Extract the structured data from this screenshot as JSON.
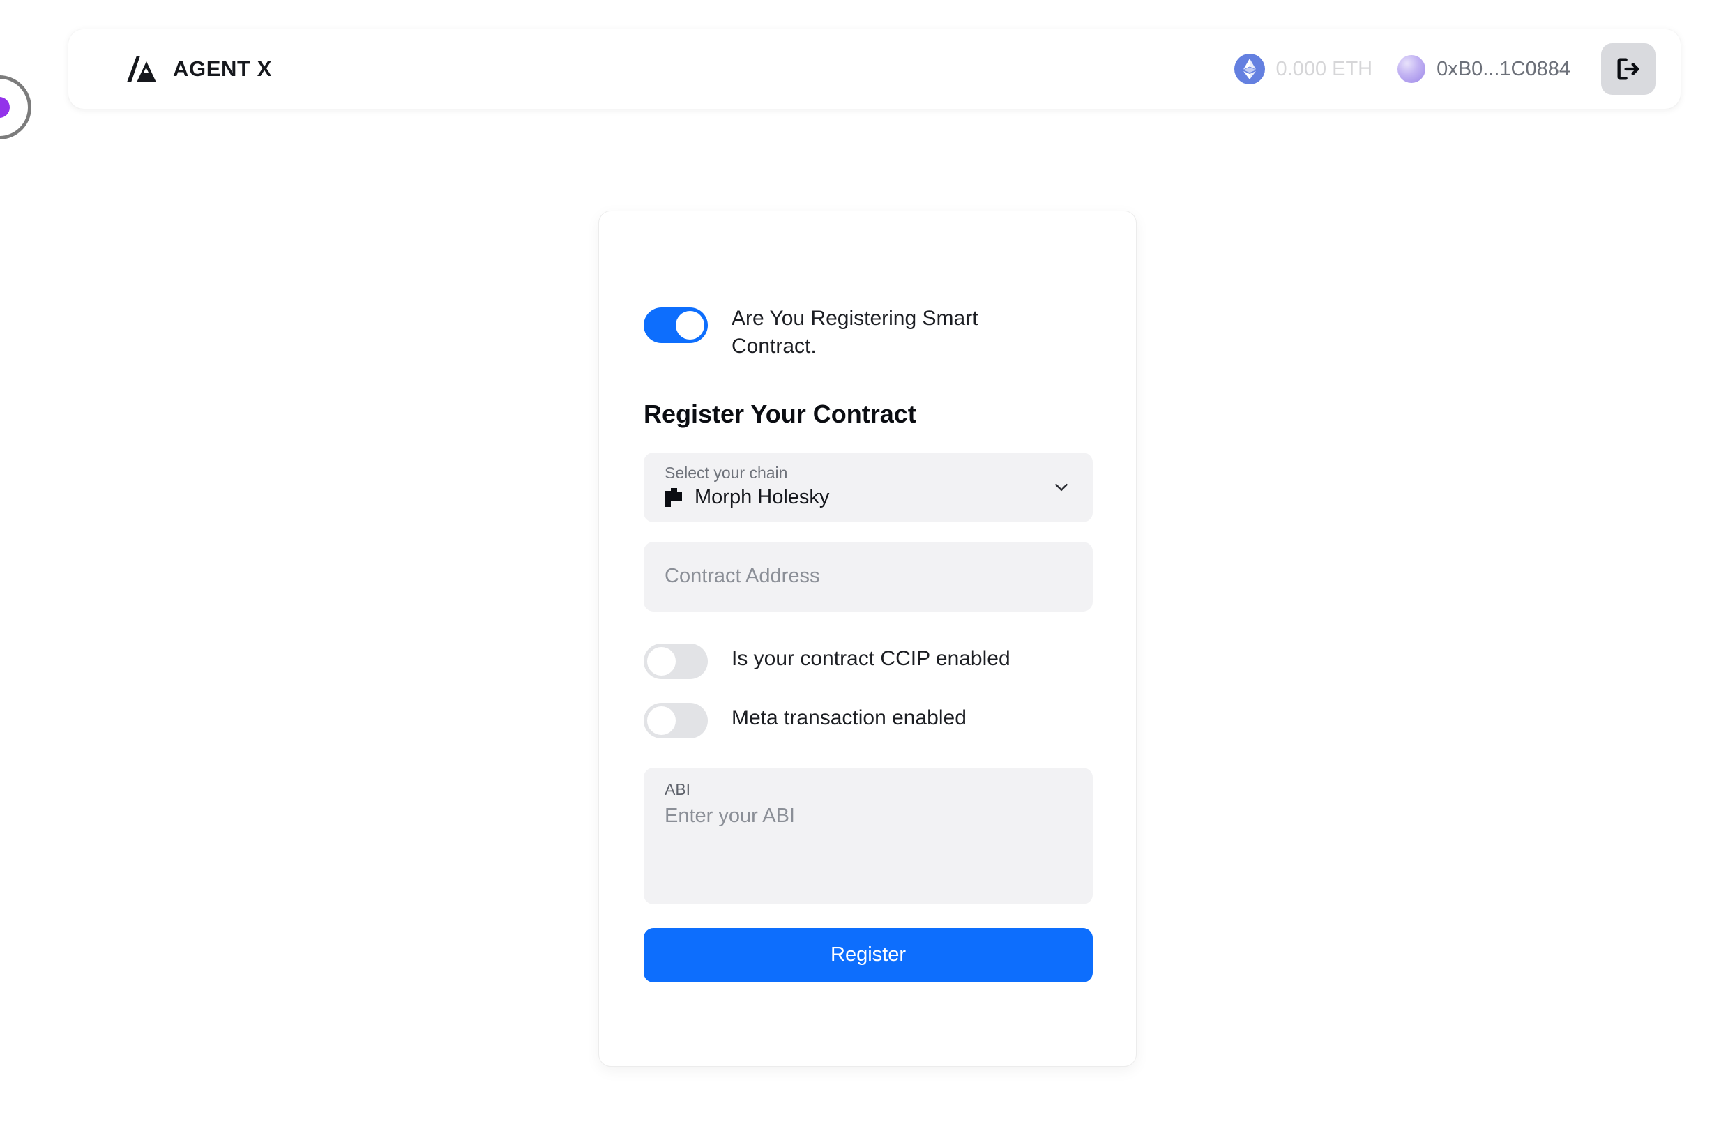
{
  "header": {
    "brand_name": "AGENT X",
    "brand_logo_icon": "agent-x-triangle-logo",
    "balance": {
      "icon": "ethereum-icon",
      "text": "0.000 ETH"
    },
    "account": {
      "avatar_icon": "wallet-avatar",
      "address": "0xB0...1C0884"
    },
    "logout_icon": "logout-icon"
  },
  "cursor": {
    "name": "cursor-ring-indicator",
    "dot_color": "#9333ea",
    "ring_color": "#7c7c7c"
  },
  "card": {
    "smart_contract_toggle": {
      "label": "Are You Registering Smart Contract.",
      "state": "on"
    },
    "title": "Register Your Contract",
    "chain_select": {
      "caption": "Select your chain",
      "value": "Morph Holesky",
      "chain_icon": "morph-logo",
      "chevron_icon": "chevron-down-icon"
    },
    "contract_address": {
      "placeholder": "Contract Address",
      "value": ""
    },
    "ccip_toggle": {
      "label": "Is your contract CCIP enabled",
      "state": "off"
    },
    "meta_toggle": {
      "label": "Meta transaction enabled",
      "state": "off"
    },
    "abi": {
      "caption": "ABI",
      "placeholder": "Enter your ABI",
      "value": ""
    },
    "submit_label": "Register"
  },
  "colors": {
    "accent_blue": "#0d6efd",
    "field_gray": "#f2f2f4",
    "page_background": "#ffffff"
  }
}
